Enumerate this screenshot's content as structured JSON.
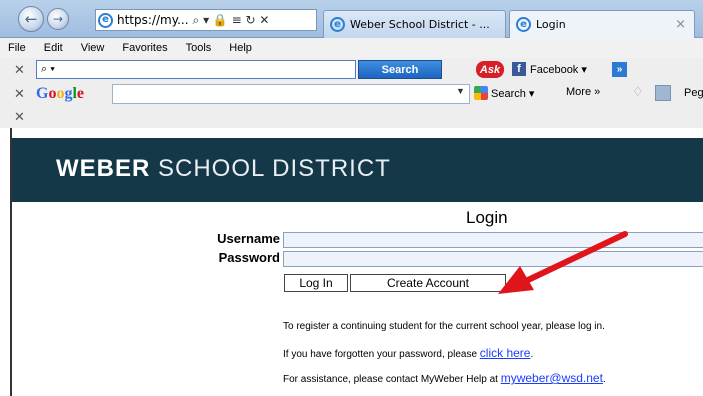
{
  "browser": {
    "address": "https://my...",
    "address_controls": "⌕ ▾ 🔒 ≡ ↻ ✕",
    "tabs": [
      {
        "label": "Weber School District - ..."
      },
      {
        "label": "Login"
      }
    ],
    "menu": [
      "File",
      "Edit",
      "View",
      "Favorites",
      "Tools",
      "Help"
    ]
  },
  "toolbars": {
    "ask": {
      "search_placeholder": "⌕ ▾",
      "search_button": "Search",
      "logo_text": "Ask",
      "facebook_label": "Facebook ▾",
      "more": "»"
    },
    "google": {
      "logo": [
        "G",
        "o",
        "o",
        "g",
        "l",
        "e"
      ],
      "search_label": "Search ▾",
      "more_label": "More »",
      "user_name": "Peg"
    },
    "close_glyph": "✕"
  },
  "page": {
    "header": {
      "brand_bold": "WEBER",
      "brand_rest": " SCHOOL DISTRICT"
    },
    "login_title": "Login",
    "username_label": "Username",
    "password_label": "Password",
    "login_button": "Log In",
    "create_button": "Create Account",
    "info_register": "To register a continuing student for the current school year, please log in.",
    "info_forgot_prefix": "If you have forgotten your password, please ",
    "info_forgot_link": "click here",
    "info_forgot_suffix": ".",
    "info_assist_prefix": "For assistance, please contact MyWeber Help at ",
    "info_assist_link": "myweber@wsd.net",
    "info_assist_suffix": "."
  },
  "colors": {
    "header_bg": "#143848",
    "link": "#1a3cff",
    "annotation_arrow": "#e0151b"
  }
}
